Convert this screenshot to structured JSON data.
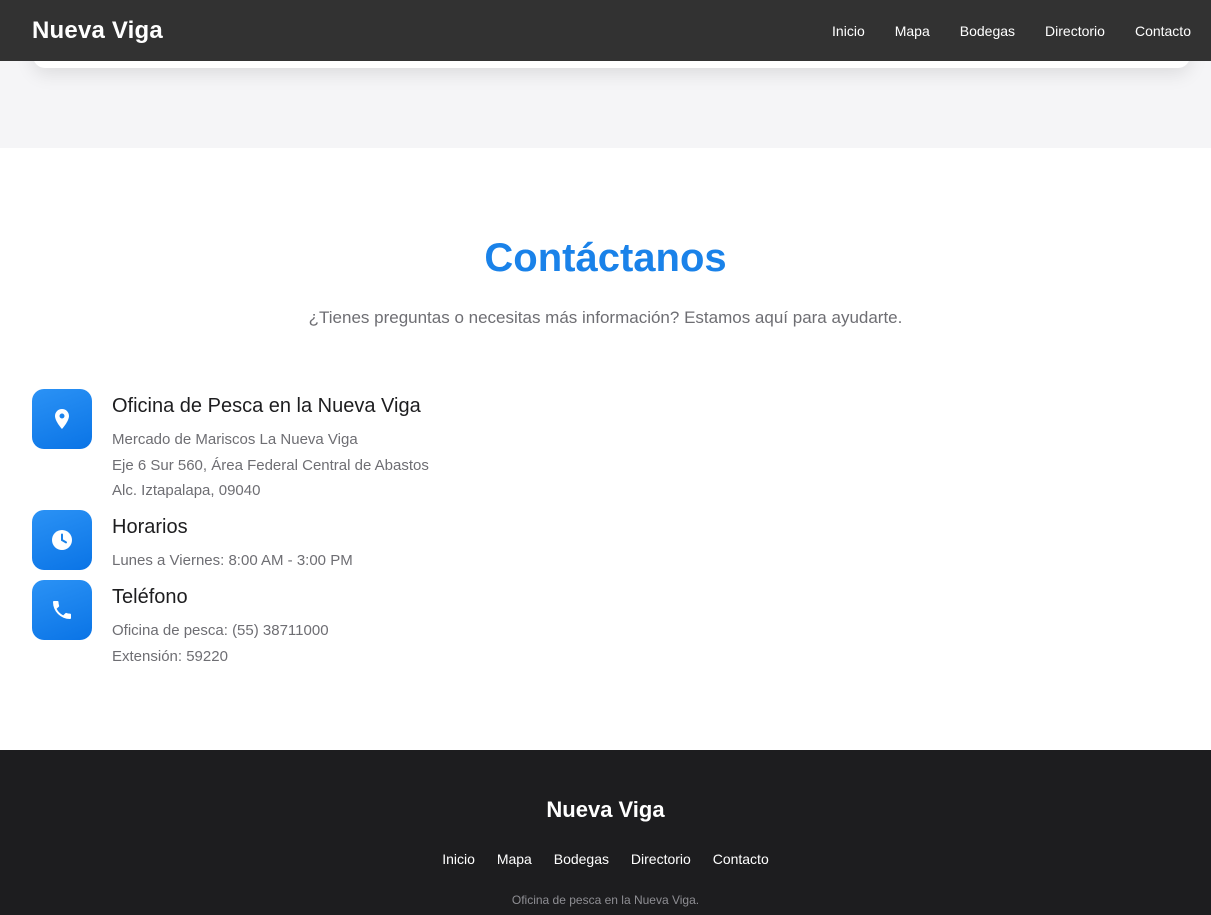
{
  "header": {
    "brand": "Nueva Viga",
    "nav": [
      "Inicio",
      "Mapa",
      "Bodegas",
      "Directorio",
      "Contacto"
    ]
  },
  "contact": {
    "title": "Contáctanos",
    "subtitle": "¿Tienes preguntas o necesitas más información? Estamos aquí para ayudarte.",
    "items": [
      {
        "icon": "map-pin-icon",
        "title": "Oficina de Pesca en la Nueva Viga",
        "lines": [
          "Mercado de Mariscos La Nueva Viga",
          "Eje 6 Sur 560, Área Federal Central de Abastos",
          "Alc. Iztapalapa, 09040"
        ]
      },
      {
        "icon": "clock-icon",
        "title": "Horarios",
        "lines": [
          "Lunes a Viernes: 8:00 AM - 3:00 PM"
        ]
      },
      {
        "icon": "phone-icon",
        "title": "Teléfono",
        "lines": [
          "Oficina de pesca: (55) 38711000",
          "Extensión: 59220"
        ]
      }
    ]
  },
  "footer": {
    "brand": "Nueva Viga",
    "nav": [
      "Inicio",
      "Mapa",
      "Bodegas",
      "Directorio",
      "Contacto"
    ],
    "note": "Oficina de pesca en la Nueva Viga."
  },
  "colors": {
    "accent": "#1a82e9",
    "header_bg": "#323232",
    "footer_bg": "#1d1d1f",
    "band_bg": "#f5f5f7",
    "muted_text": "#6e6e73"
  }
}
